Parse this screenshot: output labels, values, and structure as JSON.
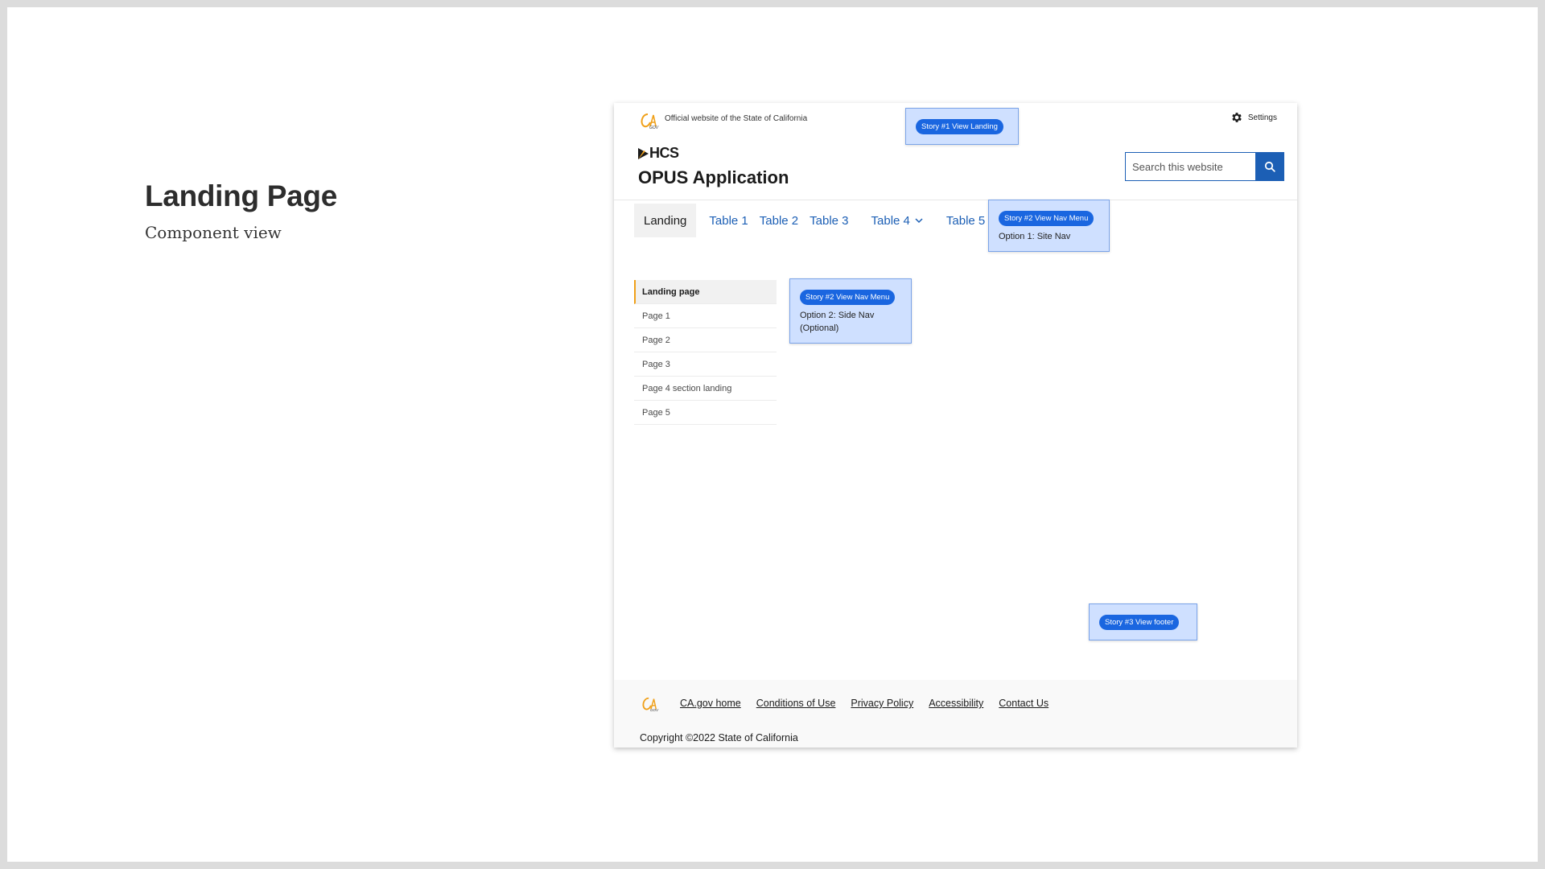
{
  "slide": {
    "title": "Landing Page",
    "subtitle": "Component view"
  },
  "header": {
    "official_text": "Official website of the State of California",
    "settings_label": "Settings",
    "brand": "HCS",
    "app_title": "OPUS Application",
    "search": {
      "placeholder": "Search this website"
    }
  },
  "nav": {
    "items": [
      {
        "label": "Landing"
      },
      {
        "label": "Table 1"
      },
      {
        "label": "Table 2"
      },
      {
        "label": "Table 3"
      },
      {
        "label": "Table 4"
      },
      {
        "label": "Table 5"
      }
    ]
  },
  "sidenav": {
    "items": [
      {
        "label": "Landing page"
      },
      {
        "label": "Page 1"
      },
      {
        "label": "Page 2"
      },
      {
        "label": "Page 3"
      },
      {
        "label": "Page 4 section landing"
      },
      {
        "label": "Page 5"
      }
    ]
  },
  "footer": {
    "links": [
      "CA.gov home",
      "Conditions of Use",
      "Privacy Policy",
      "Accessibility",
      "Contact Us"
    ],
    "copyright": "Copyright ©2022 State of California"
  },
  "stories": [
    {
      "pill": "Story #1 View Landing",
      "text": ""
    },
    {
      "pill": "Story #2  View Nav Menu",
      "text": "Option 1: Site Nav"
    },
    {
      "pill": "Story #2  View Nav Menu",
      "text": "Option 2: Side Nav (Optional)"
    },
    {
      "pill": "Story #3  View footer",
      "text": ""
    }
  ],
  "colors": {
    "primary": "#1c5fb5",
    "accent": "#f0a019",
    "story_pill": "#1a66e0",
    "story_bg": "#c8dcff"
  }
}
